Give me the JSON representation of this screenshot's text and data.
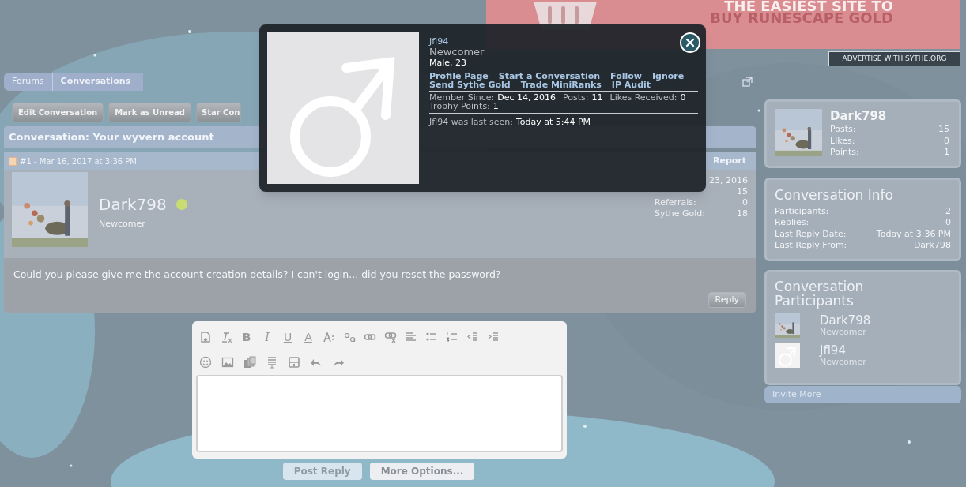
{
  "banner": {
    "headline": "THE EASIEST SITE TO",
    "subline": "BUY RUNESCAPE GOLD",
    "advertise": "ADVERTISE WITH SYTHE.ORG"
  },
  "breadcrumbs": [
    {
      "label": "Forums",
      "selected": false
    },
    {
      "label": "Conversations",
      "selected": true
    }
  ],
  "actions": [
    "Edit Conversation",
    "Mark as Unread",
    "Star Con"
  ],
  "conversation": {
    "title": "Conversation: Your wyvern account",
    "message": {
      "meta": "#1 - Mar 16, 2017 at 3:36 PM",
      "report": "Report",
      "author": "Dark798",
      "online": true,
      "rank": "Newcomer",
      "stats": [
        {
          "value": "23, 2016"
        },
        {
          "value": "15"
        },
        {
          "label": "Referrals:",
          "value": "0"
        },
        {
          "label": "Sythe Gold:",
          "value": "18"
        }
      ],
      "text": "Could you please give me the account creation details? I can't login... did you reset the password?",
      "reply": "Reply"
    }
  },
  "editor": {
    "text_buttons": [
      "B",
      "I",
      "U",
      "A"
    ]
  },
  "buttons": [
    {
      "label": "Post Reply",
      "kind": "primary"
    },
    {
      "label": "More Options...",
      "kind": "secondary"
    }
  ],
  "sidebar": {
    "member": {
      "name": "Dark798",
      "stats": [
        {
          "label": "Posts:",
          "value": "15"
        },
        {
          "label": "Likes:",
          "value": "0"
        },
        {
          "label": "Points:",
          "value": "1"
        }
      ]
    },
    "info": {
      "title": "Conversation Info",
      "rows": [
        {
          "label": "Participants:",
          "value": "2"
        },
        {
          "label": "Replies:",
          "value": "0"
        },
        {
          "label": "Last Reply Date:",
          "value": "Today at 3:36 PM"
        },
        {
          "label": "Last Reply From:",
          "value": "Dark798"
        }
      ]
    },
    "participants": {
      "title": "Conversation Participants",
      "people": [
        {
          "name": "Dark798",
          "rank": "Newcomer"
        },
        {
          "name": "Jfl94",
          "rank": "Newcomer",
          "kind": "symbol"
        }
      ]
    },
    "invite": "Invite More"
  },
  "popup": {
    "name": "Jfl94",
    "title": "Newcomer",
    "details": "Male, 23",
    "links": [
      [
        "Profile Page",
        "Start a Conversation",
        "Follow",
        "Ignore"
      ],
      [
        "Send Sythe Gold",
        "Trade MiniRanks",
        "IP Audit"
      ]
    ],
    "facts": [
      {
        "label": "Member Since:",
        "value": "Dec 14, 2016"
      },
      {
        "label": "Posts:",
        "value": "11"
      },
      {
        "label": "Likes Received:",
        "value": "0"
      },
      {
        "label": "Trophy Points:",
        "value": "1"
      }
    ],
    "last_seen": {
      "label": "Jfl94 was last seen:",
      "value": "Today at 5:44 PM"
    }
  }
}
